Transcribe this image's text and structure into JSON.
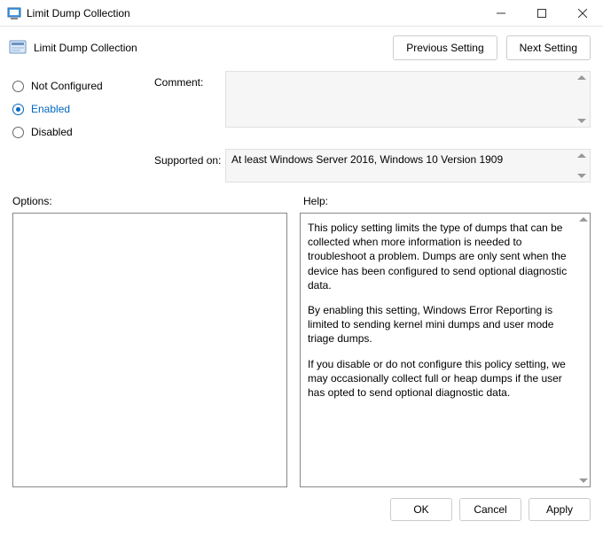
{
  "window": {
    "title": "Limit Dump Collection"
  },
  "header": {
    "title": "Limit Dump Collection",
    "prev_label": "Previous Setting",
    "next_label": "Next Setting"
  },
  "state": {
    "not_configured_label": "Not Configured",
    "enabled_label": "Enabled",
    "disabled_label": "Disabled",
    "selected": "enabled"
  },
  "labels": {
    "comment": "Comment:",
    "supported_on": "Supported on:",
    "options": "Options:",
    "help": "Help:"
  },
  "comment": {
    "value": ""
  },
  "supported_on": {
    "value": "At least Windows Server 2016, Windows 10 Version 1909"
  },
  "help": {
    "p1": "This policy setting limits the type of dumps that can be collected when more information is needed to troubleshoot a problem. Dumps are only sent when the device has been configured to send optional diagnostic data.",
    "p2": "By enabling this setting, Windows Error Reporting is limited to sending kernel mini dumps and user mode triage dumps.",
    "p3": "If you disable or do not configure this policy setting, we may occasionally collect full or heap dumps if the user has opted to send optional diagnostic data."
  },
  "footer": {
    "ok": "OK",
    "cancel": "Cancel",
    "apply": "Apply"
  }
}
